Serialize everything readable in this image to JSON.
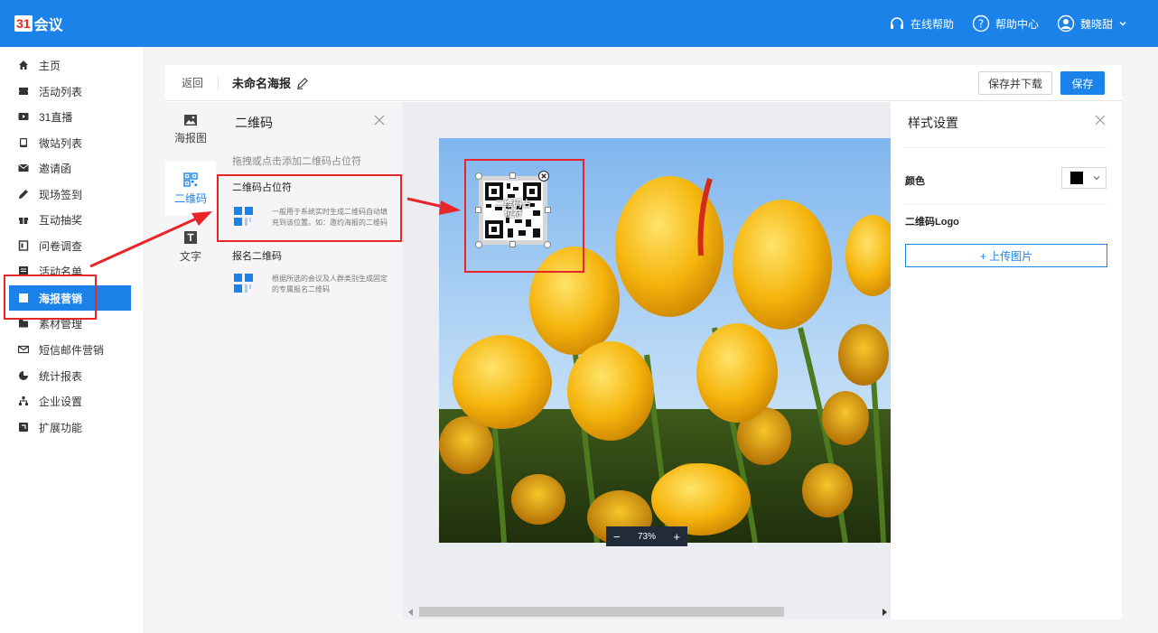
{
  "header": {
    "logo_mark": "31",
    "logo_text": "会议",
    "online_help": "在线帮助",
    "help_center": "帮助中心",
    "user_name": "魏晓甜"
  },
  "sidebar": {
    "items": [
      {
        "label": "主页",
        "icon": "home-icon"
      },
      {
        "label": "活动列表",
        "icon": "ticket-icon"
      },
      {
        "label": "31直播",
        "icon": "video-icon"
      },
      {
        "label": "微站列表",
        "icon": "phone-icon"
      },
      {
        "label": "邀请函",
        "icon": "mail-icon"
      },
      {
        "label": "现场签到",
        "icon": "pen-icon"
      },
      {
        "label": "互动抽奖",
        "icon": "gift-icon"
      },
      {
        "label": "问卷调查",
        "icon": "survey-icon"
      },
      {
        "label": "活动名单",
        "icon": "list-icon"
      },
      {
        "label": "海报营销",
        "icon": "poster-icon",
        "active": true
      },
      {
        "label": "素材管理",
        "icon": "folder-icon"
      },
      {
        "label": "短信邮件营销",
        "icon": "envelope-icon"
      },
      {
        "label": "统计报表",
        "icon": "pie-chart-icon"
      },
      {
        "label": "企业设置",
        "icon": "org-icon"
      },
      {
        "label": "扩展功能",
        "icon": "extension-icon"
      }
    ]
  },
  "editor": {
    "back_label": "返回",
    "poster_title": "未命名海报",
    "save_download_label": "保存并下载",
    "save_label": "保存"
  },
  "tools": {
    "poster_image": "海报图",
    "qr_code": "二维码",
    "text": "文字"
  },
  "qr_panel": {
    "title": "二维码",
    "hint": "拖拽或点击添加二维码占位符",
    "cards": [
      {
        "title": "二维码占位符",
        "desc": "一般用于系统实时生成二维码自动填充到该位置。如：邀约海报的二维码"
      },
      {
        "title": "报名二维码",
        "desc": "根据所选的会议及人群类别生成固定的专属报名二维码"
      }
    ]
  },
  "canvas": {
    "placeholder_label": "二维码占位符",
    "zoom_level": "73%",
    "zoom_minus": "−",
    "zoom_plus": "+"
  },
  "style_panel": {
    "title": "样式设置",
    "color_label": "颜色",
    "color_value": "#000000",
    "logo_label": "二维码Logo",
    "upload_label": "+ 上传图片"
  },
  "colors": {
    "primary": "#1a82e8",
    "annotation": "#e8262a"
  }
}
